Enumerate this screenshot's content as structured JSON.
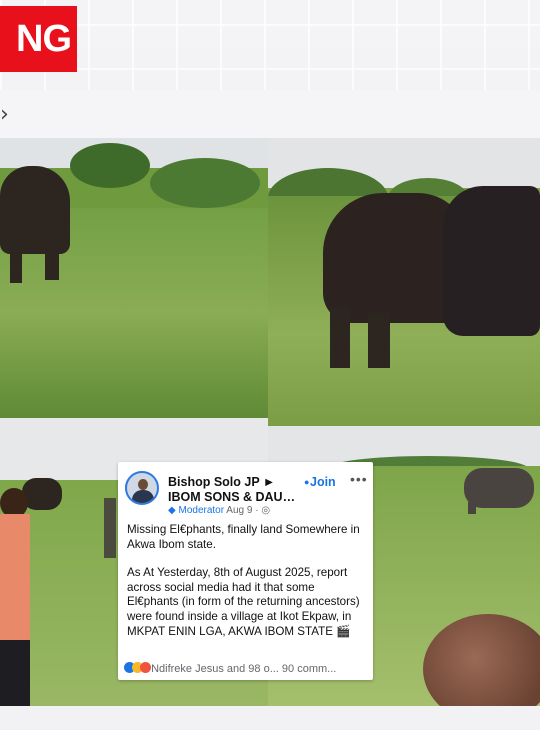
{
  "badge": {
    "text": "NG"
  },
  "browser": {
    "chevron": "›"
  },
  "post": {
    "author": "Bishop Solo JP ► IBOM SONS & DAU…",
    "join_label": "Join",
    "role": "Moderator",
    "date": "Aug 9",
    "paragraph1": "Missing El€phants, finally land Somewhere in Akwa Ibom state.",
    "paragraph2": "As At Yesterday,  8th of August 2025, report across social media had it that some El€phants (in form of the returning ancestors) were found inside a village at Ikot Ekpaw, in MKPAT ENIN LGA, AKWA IBOM STATE 🎬",
    "reactions": "Ndifreke Jesus and 98 o...",
    "comments": "90 comm..."
  }
}
